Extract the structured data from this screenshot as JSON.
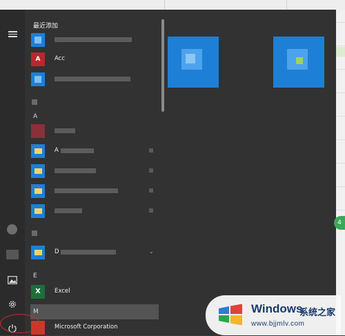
{
  "start_menu": {
    "recently_added_label": "最近添加",
    "sections": [
      {
        "letter": "A"
      },
      {
        "letter": "E"
      },
      {
        "letter": "M"
      }
    ],
    "apps": [
      {
        "label": "",
        "icon": "blue-app-icon"
      },
      {
        "label": "Acc",
        "icon": "access-icon",
        "tile_text": "A"
      },
      {
        "label": "",
        "icon": "blue-app-icon"
      },
      {
        "label": "",
        "icon": "red-app-icon"
      },
      {
        "label": "A",
        "icon": "folder-icon"
      },
      {
        "label": "",
        "icon": "folder-icon"
      },
      {
        "label": "",
        "icon": "folder-icon"
      },
      {
        "label": "",
        "icon": "folder-icon"
      },
      {
        "label": "D",
        "icon": "folder-icon"
      },
      {
        "label": "Excel",
        "icon": "excel-icon",
        "tile_text": "X"
      },
      {
        "label": "Microsoft Corporation",
        "icon": "office-icon"
      }
    ]
  },
  "side_badge": "4",
  "watermark": {
    "brand": "Windows",
    "cn": "系统之家",
    "url": "www.bjjmlv.com"
  },
  "colors": {
    "accent": "#1e7fd6",
    "background": "#323232",
    "highlight": "#d42a2a"
  }
}
